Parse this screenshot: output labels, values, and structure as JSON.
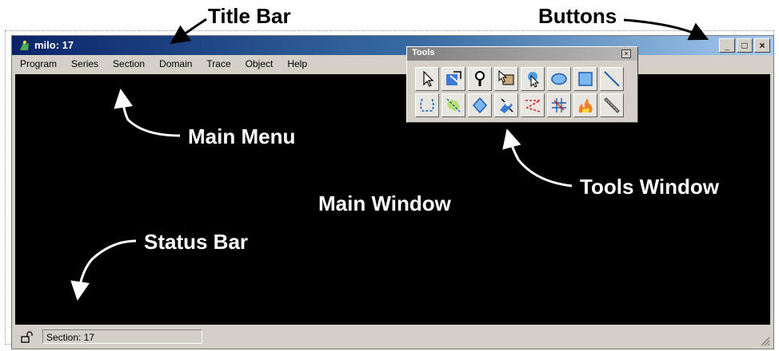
{
  "annotations": {
    "title_bar": "Title Bar",
    "buttons": "Buttons",
    "main_menu": "Main Menu",
    "tools_window": "Tools Window",
    "main_window": "Main Window",
    "status_bar": "Status Bar"
  },
  "window": {
    "title": "milo: 17",
    "buttons": {
      "minimize": "_",
      "maximize": "□",
      "close": "×"
    }
  },
  "menu": {
    "items": [
      {
        "label": "Program"
      },
      {
        "label": "Series"
      },
      {
        "label": "Section"
      },
      {
        "label": "Domain"
      },
      {
        "label": "Trace"
      },
      {
        "label": "Object"
      },
      {
        "label": "Help"
      }
    ]
  },
  "tools": {
    "title": "Tools",
    "close": "×",
    "icons": [
      "pointer-icon",
      "pan-zoom-icon",
      "magnify-icon",
      "domain-select-icon",
      "trace-select-icon",
      "ellipse-icon",
      "rectangle-icon",
      "line-icon",
      "polyline-icon",
      "closed-trace-icon",
      "wildfire-icon",
      "grab-icon",
      "scissor-icon",
      "cross-icon",
      "fire-icon",
      "ruler-icon"
    ]
  },
  "status": {
    "section": "Section: 17"
  },
  "colors": {
    "title_bar_start": "#0a246a",
    "title_bar_end": "#a6caf0",
    "main_window": "#000000",
    "chrome": "#d4d0c8"
  }
}
